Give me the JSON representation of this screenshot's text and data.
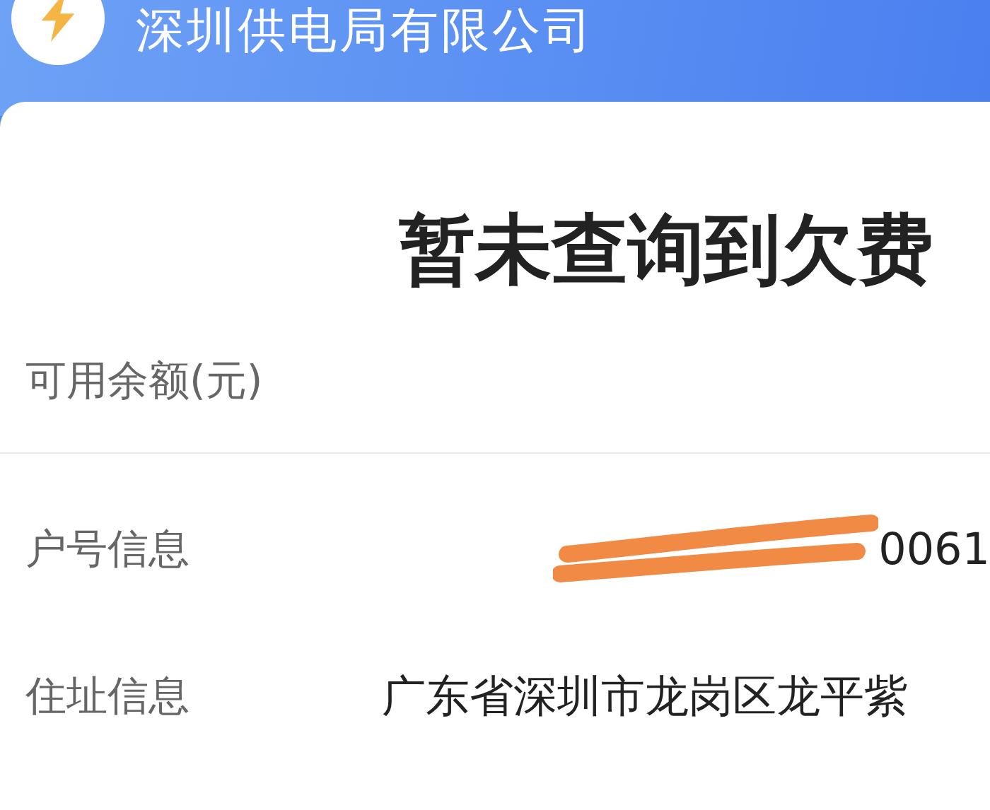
{
  "header": {
    "title": "深圳供电局有限公司"
  },
  "status": {
    "message": "暂未查询到欠费"
  },
  "balance": {
    "label": "可用余额(元)"
  },
  "info_rows": [
    {
      "label": "户号信息",
      "value": "0061",
      "kind": "redacted"
    },
    {
      "label": "住址信息",
      "value": "广东省深圳市龙岗区龙平紫",
      "kind": "plain"
    }
  ]
}
